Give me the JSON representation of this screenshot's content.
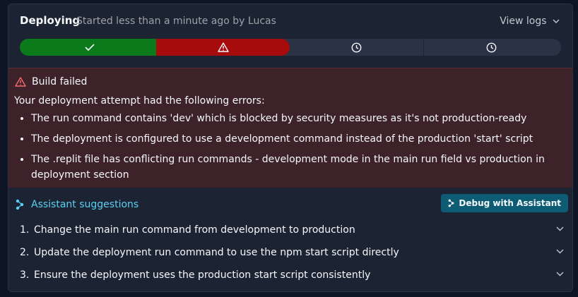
{
  "header": {
    "title": "Deploying",
    "subtitle": "Started less than a minute ago by Lucas",
    "view_logs": "View logs"
  },
  "progress": {
    "steps": [
      {
        "status": "success",
        "icon": "check-icon"
      },
      {
        "status": "failed",
        "icon": "warning-icon"
      },
      {
        "status": "pending",
        "icon": "clock-icon"
      },
      {
        "status": "pending",
        "icon": "clock-icon"
      }
    ],
    "colors": {
      "success": "#0a7a1b",
      "failed": "#a60c0c",
      "pending": "#2b3245"
    }
  },
  "error": {
    "title": "Build failed",
    "intro": "Your deployment attempt had the following errors:",
    "items": [
      "The run command contains 'dev' which is blocked by security measures as it's not production-ready",
      "The deployment is configured to use a development command instead of the production 'start' script",
      "The .replit file has conflicting run commands - development mode in the main run field vs production in deployment section"
    ]
  },
  "assistant": {
    "label": "Assistant suggestions",
    "debug_button": "Debug with Assistant",
    "suggestions": [
      {
        "num": "1.",
        "text": "Change the main run command from development to production"
      },
      {
        "num": "2.",
        "text": "Update the deployment run command to use the npm start script directly"
      },
      {
        "num": "3.",
        "text": "Ensure the deployment uses the production start script consistently"
      }
    ]
  }
}
